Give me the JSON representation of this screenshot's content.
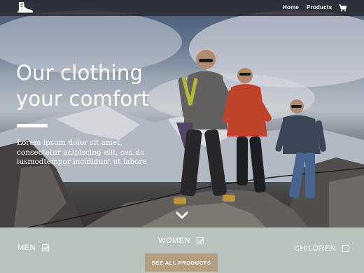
{
  "nav": {
    "logo_icon": "hiking-boot-icon",
    "links": {
      "home": "Home",
      "products": "Products"
    },
    "cart_icon": "shopping-cart-icon"
  },
  "hero": {
    "headline_line1": "Our clothing",
    "headline_line2": "your comfort",
    "body_line1": "Lorem ipsum dolor sit amet,",
    "body_line2": "consectetur adipiscing elit, sed do",
    "body_line3": "iusmodtempor incididunt ut labore",
    "scroll_icon": "chevron-down-icon"
  },
  "categories": {
    "men": {
      "label": "MEN",
      "checked": true
    },
    "women": {
      "label": "WOMEN",
      "checked": true
    },
    "children": {
      "label": "CHILDREN",
      "checked": false
    }
  },
  "cta": {
    "label": "SEE ALL PRODUCTS"
  },
  "colors": {
    "nav_bg": "#28282d",
    "category_bar": "#b9c3be",
    "cta_button": "#b59e80",
    "text": "#ffffff"
  }
}
